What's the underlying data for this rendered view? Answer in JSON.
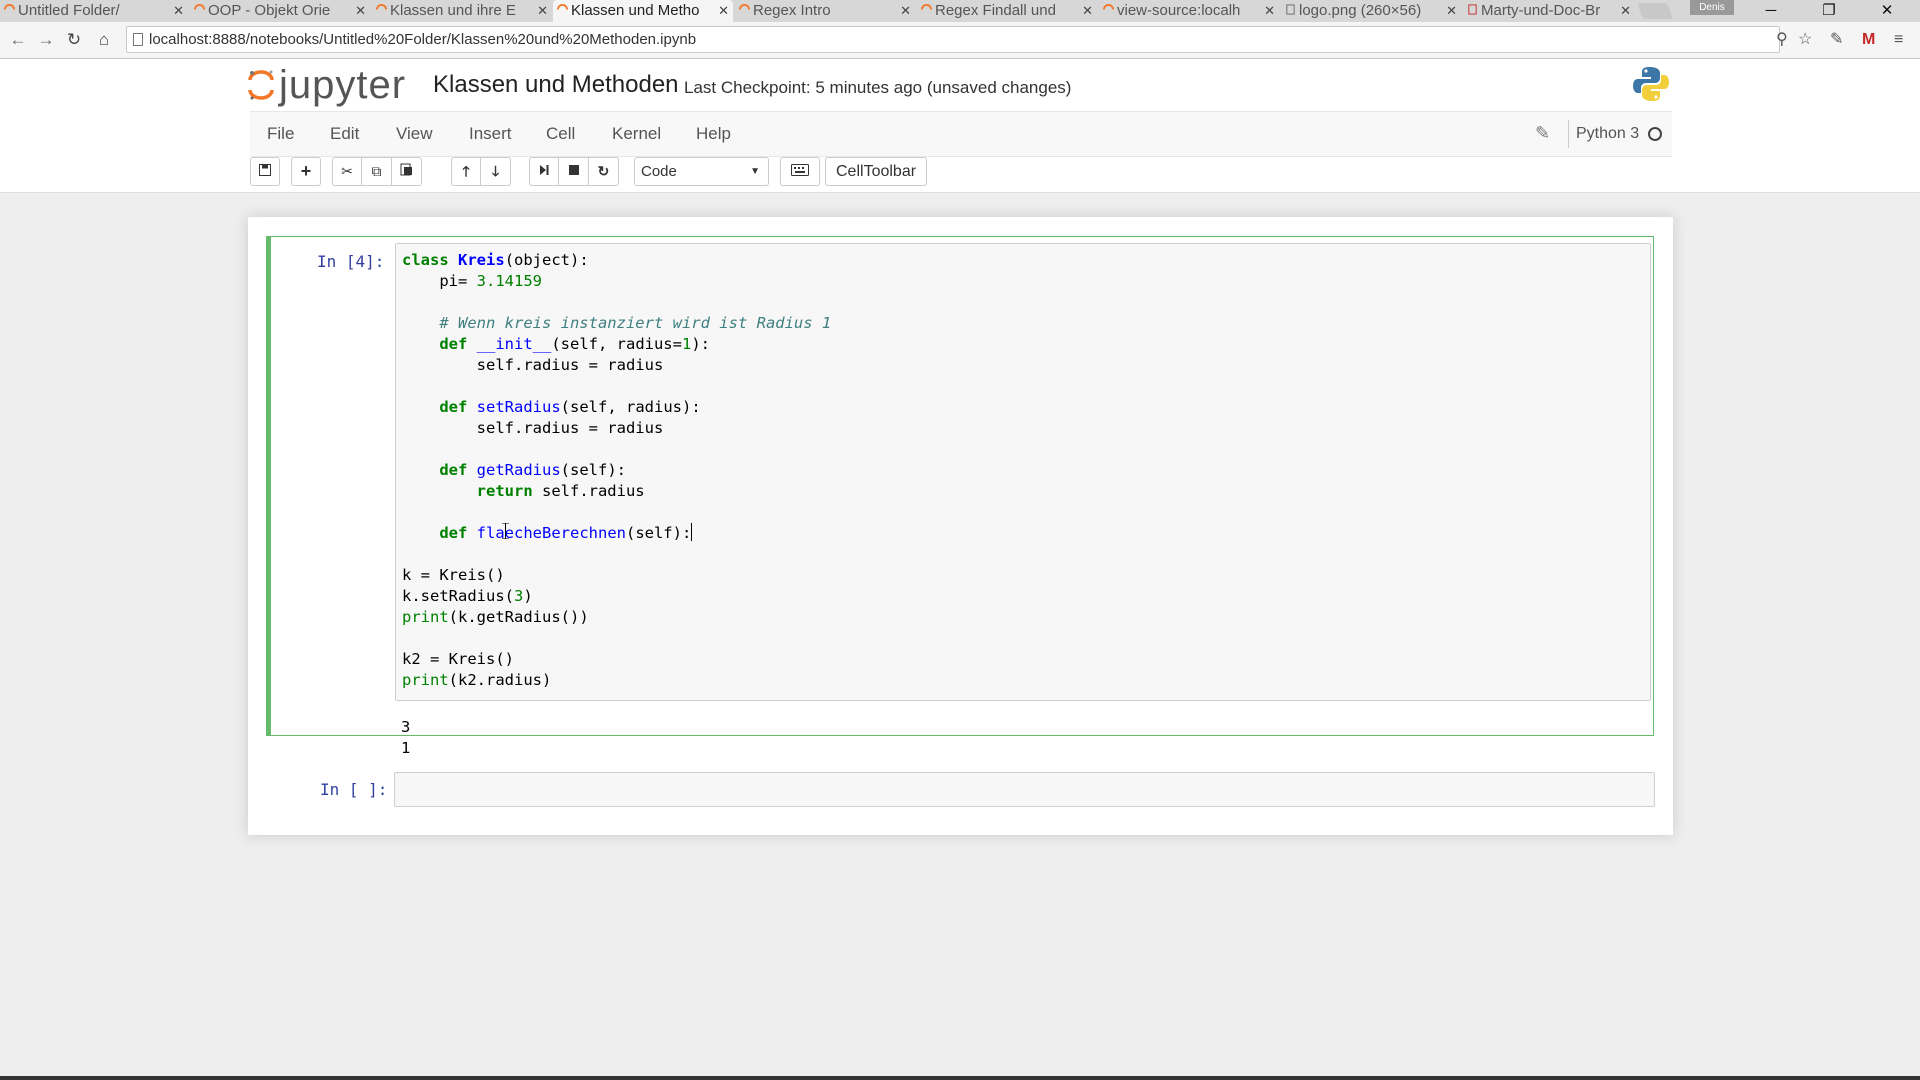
{
  "browser": {
    "tabs": [
      {
        "title": "Untitled Folder/"
      },
      {
        "title": "OOP - Objekt Orie"
      },
      {
        "title": "Klassen und ihre E"
      },
      {
        "title": "Klassen und Metho"
      },
      {
        "title": "Regex Intro"
      },
      {
        "title": "Regex Findall und"
      },
      {
        "title": "view-source:localh"
      },
      {
        "title": "logo.png (260×56)"
      },
      {
        "title": "Marty-und-Doc-Br"
      }
    ],
    "active_tab_index": 3,
    "profile_name": "Denis",
    "url": "localhost:8888/notebooks/Untitled%20Folder/Klassen%20und%20Methoden.ipynb"
  },
  "jupyter": {
    "logo_text": "jupyter",
    "notebook_name": "Klassen und Methoden",
    "checkpoint": "Last Checkpoint: 5 minutes ago (unsaved changes)",
    "menu": [
      "File",
      "Edit",
      "View",
      "Insert",
      "Cell",
      "Kernel",
      "Help"
    ],
    "kernel_name": "Python 3",
    "cell_type": "Code",
    "celltoolbar_label": "CellToolbar"
  },
  "cells": [
    {
      "prompt": "In [4]:",
      "output": [
        "3",
        "1"
      ]
    },
    {
      "prompt": "In [ ]:"
    }
  ],
  "code_tokens": {
    "line1_kw": "class",
    "line1_cls": "Kreis",
    "line1_rest": "(object):",
    "line2_a": "    pi= ",
    "line2_num": "3.14159",
    "line4_cm": "    # Wenn kreis instanziert wird ist Radius 1",
    "def": "def",
    "init_fn": "__init__",
    "init_rest_a": "(self, radius=",
    "init_num": "1",
    "init_rest_b": "):",
    "assign": "        self.radius = radius",
    "set_fn": "setRadius",
    "set_rest": "(self, radius):",
    "get_fn": "getRadius",
    "get_rest": "(self):",
    "ret_kw": "return",
    "ret_rest": " self.radius",
    "fl_fn": "flaecheBerechnen",
    "fl_rest": "(self):",
    "k_assign": "k = Kreis()",
    "k_set_a": "k.setRadius(",
    "k_set_num": "3",
    "k_set_b": ")",
    "print": "print",
    "print1_rest": "(k.getRadius())",
    "k2_assign": "k2 = Kreis()",
    "print2_rest": "(k2.radius)"
  }
}
